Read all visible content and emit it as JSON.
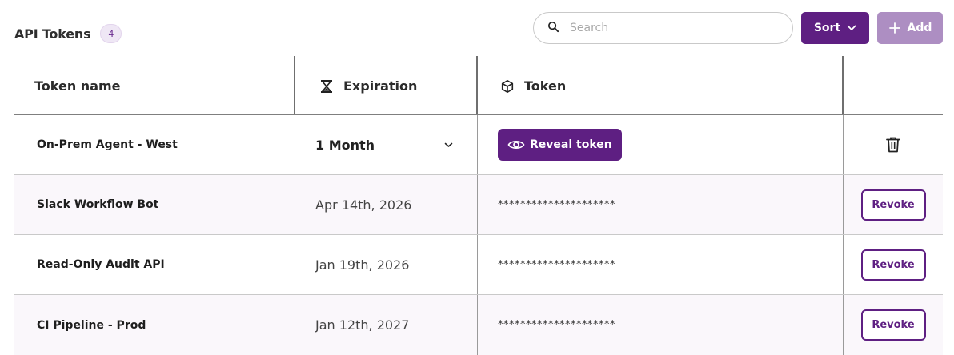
{
  "header": {
    "title": "API Tokens",
    "count": "4",
    "search_placeholder": "Search",
    "sort_label": "Sort",
    "add_label": "Add"
  },
  "table": {
    "columns": {
      "name": "Token name",
      "expiration": "Expiration",
      "token": "Token"
    },
    "new_row": {
      "name": "On-Prem Agent - West",
      "expiration": "1 Month",
      "reveal_label": "Reveal token"
    },
    "rows": [
      {
        "name": "Slack Workflow Bot",
        "expiration": "Apr 14th, 2026",
        "token": "*********************",
        "action": "Revoke"
      },
      {
        "name": "Read-Only Audit API",
        "expiration": "Jan 19th, 2026",
        "token": "*********************",
        "action": "Revoke"
      },
      {
        "name": "CI Pipeline - Prod",
        "expiration": "Jan 12th, 2027",
        "token": "*********************",
        "action": "Revoke"
      }
    ]
  },
  "icons": {
    "search": "search-icon",
    "sort": "chevron-down-icon",
    "add": "plus-icon",
    "expiration": "hourglass-icon",
    "token": "cube-icon",
    "reveal": "eye-icon",
    "delete": "trash-icon",
    "select": "chevron-down-icon"
  },
  "colors": {
    "primary": "#5e1f82",
    "primary_disabled": "#ad8ec2",
    "badge_bg": "#efe7f5",
    "alt_row_bg": "#faf7fb"
  }
}
